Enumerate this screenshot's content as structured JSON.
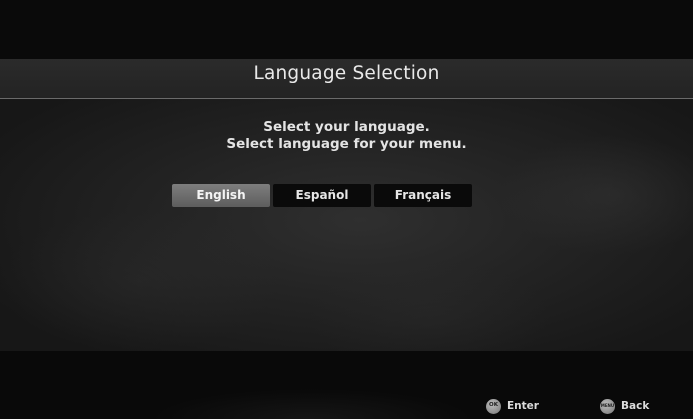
{
  "screen": {
    "title": "Language Selection",
    "instructions": {
      "line1": "Select your language.",
      "line2": "Select language for your menu."
    },
    "languages": [
      {
        "label": "English",
        "selected": true
      },
      {
        "label": "Español",
        "selected": false
      },
      {
        "label": "Français",
        "selected": false
      }
    ]
  },
  "footer": {
    "enter": {
      "key": "OK",
      "label": "Enter",
      "icon": "ok-button-icon"
    },
    "back": {
      "key": "MENU",
      "label": "Back",
      "icon": "menu-button-icon"
    }
  },
  "colors": {
    "background": "#0b0b0b",
    "title_band": "#2b2b2b",
    "selected_button": "#6e6e6e",
    "unselected_button": "#0a0a0a",
    "text": "#e6e6e6"
  }
}
